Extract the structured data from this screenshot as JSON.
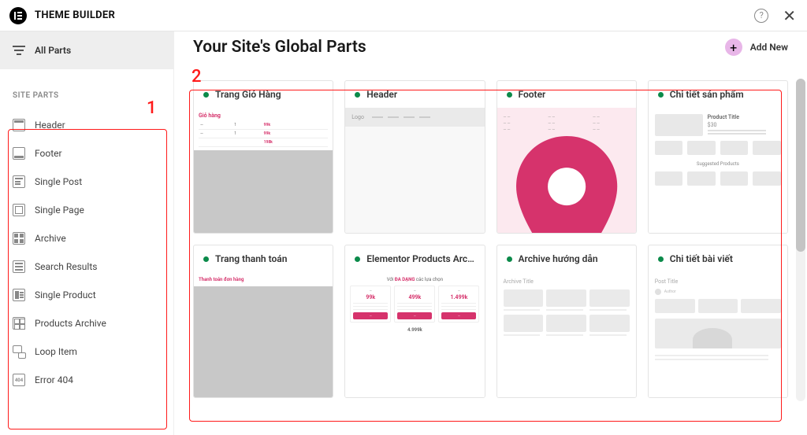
{
  "app_title": "THEME BUILDER",
  "sidebar": {
    "all_parts": "All Parts",
    "section_label": "SITE PARTS",
    "items": [
      {
        "label": "Header",
        "icon": "header"
      },
      {
        "label": "Footer",
        "icon": "footer"
      },
      {
        "label": "Single Post",
        "icon": "singlepost"
      },
      {
        "label": "Single Page",
        "icon": "singlepage"
      },
      {
        "label": "Archive",
        "icon": "archive"
      },
      {
        "label": "Search Results",
        "icon": "search"
      },
      {
        "label": "Single Product",
        "icon": "singleproduct"
      },
      {
        "label": "Products Archive",
        "icon": "parchive"
      },
      {
        "label": "Loop Item",
        "icon": "loop"
      },
      {
        "label": "Error 404",
        "icon": "e404"
      }
    ]
  },
  "main": {
    "title": "Your Site's Global Parts",
    "add_new": "Add New"
  },
  "annotations": {
    "one": "1",
    "two": "2"
  },
  "cards": [
    {
      "title": "Trang Giỏ Hàng",
      "thumb": "cart"
    },
    {
      "title": "Header",
      "thumb": "header"
    },
    {
      "title": "Footer",
      "thumb": "footer"
    },
    {
      "title": "Chi tiết sản phẩm",
      "thumb": "product"
    },
    {
      "title": "Trang thanh toán",
      "thumb": "checkout"
    },
    {
      "title": "Elementor Products Archiv...",
      "thumb": "pricing"
    },
    {
      "title": "Archive hướng dẫn",
      "thumb": "archive"
    },
    {
      "title": "Chi tiết bài viết",
      "thumb": "post"
    }
  ],
  "thumbs": {
    "cart_title": "Giỏ hàng",
    "checkout_title": "Thanh toán đơn hàng",
    "header_logo": "Logo",
    "product_title": "Product Title",
    "product_price": "$30",
    "product_suggested": "Suggested Products",
    "pricing_heading_pre": "Với ",
    "pricing_heading_accent": "ĐA DẠNG",
    "pricing_heading_post": " các lựa chọn",
    "pricing_tiers": [
      "99k",
      "499k",
      "1.499k"
    ],
    "pricing_more": "4.999k",
    "archive_title": "Archive Title",
    "post_title": "Post Title",
    "post_author": "Author",
    "e404": "404"
  }
}
